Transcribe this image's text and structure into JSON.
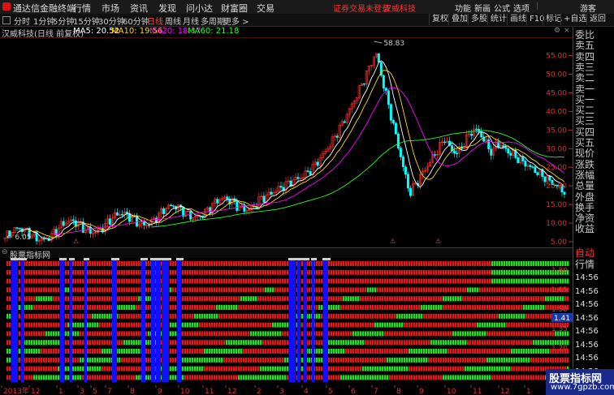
{
  "titlebar": {
    "app_name": "通达信金融终端",
    "menus": [
      "行情",
      "市场",
      "资讯",
      "发现",
      "问小达",
      "财富圈",
      "交易"
    ],
    "warning": "证券交易未登录",
    "stock_name": "汉威科技",
    "right_items": [
      "功能",
      "新画",
      "公式",
      "选项",
      "|",
      "游客"
    ]
  },
  "toolbar": {
    "periods": [
      "分时",
      "1分钟",
      "5分钟",
      "15分钟",
      "30分钟",
      "60分钟",
      "日线",
      "周线",
      "月线",
      "多周期",
      "更多 >"
    ],
    "active_period": "日线",
    "right_buttons": [
      "复权",
      "叠加",
      "多股",
      "统计",
      "画线",
      "F10",
      "标记",
      "+自选",
      "返回"
    ]
  },
  "chart": {
    "title": "汉威科技(日线 前复权)",
    "ma": [
      {
        "label": "MA5: 20.52",
        "color": "#ffffff"
      },
      {
        "label": "MA10: 19.56",
        "color": "#ffd700"
      },
      {
        "label": "MA20: 18.37",
        "color": "#ff00ff"
      },
      {
        "label": "MA60: 21.18",
        "color": "#22ff22"
      }
    ],
    "high_label": "58.83",
    "low_label": "6.05",
    "y_ticks": [
      "55.00",
      "50.00",
      "45.00",
      "40.00",
      "35.00",
      "30.00",
      "25.00",
      "20.00",
      "15.00",
      "10.00",
      "5.00"
    ],
    "marker": "⚠"
  },
  "indicator": {
    "title": "股票指标网",
    "y_ticks": [
      "1.80",
      "1.65",
      "1.50",
      "1.35",
      "1.20"
    ],
    "current_value": "1.41"
  },
  "x_axis": {
    "labels": [
      "2013年",
      "12",
      "1",
      "3",
      "5",
      "7",
      "8",
      "9",
      "10",
      "11",
      "12",
      "2",
      "3",
      "4",
      "5",
      "6",
      "7",
      "8",
      "9",
      "10",
      "11",
      "12",
      "1"
    ]
  },
  "right_panel": {
    "quote_labels": [
      "委比",
      "卖五",
      "卖四",
      "卖三",
      "卖二",
      "卖一",
      "买一",
      "买二",
      "买三",
      "买四",
      "买五",
      "现价",
      "涨跌",
      "涨幅",
      "总量",
      "外盘",
      "换手",
      "净资",
      "收益"
    ],
    "section_label": "自动",
    "trade_label": "行情",
    "times": [
      "14:56",
      "14:56",
      "14:56",
      "14:56",
      "14:56",
      "14:56",
      "14:56",
      "14:56",
      "14:56"
    ]
  },
  "watermark": {
    "title": "股票指标网",
    "url": "www.7gpzb.com"
  }
}
